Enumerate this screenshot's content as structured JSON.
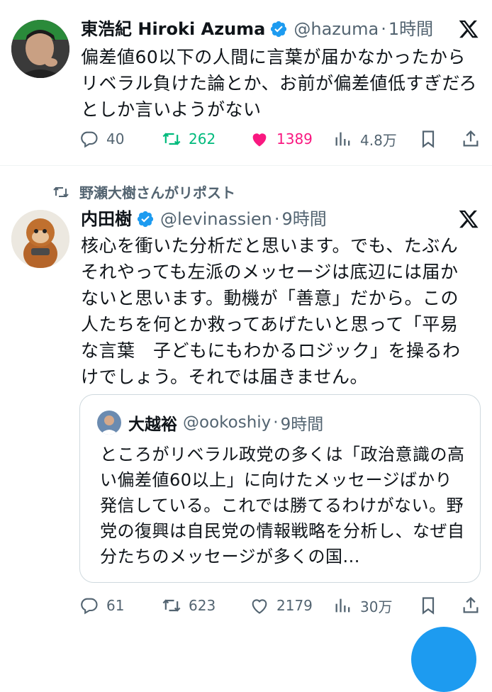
{
  "tweet1": {
    "name": "東浩紀 Hiroki Azuma",
    "handle": "@hazuma",
    "separator": "·",
    "time": "1時間",
    "body": "偏差値60以下の人間に言葉が届かなかったからリベラル負けた論とか、お前が偏差値低すぎだろとしか言いようがない",
    "replies": "40",
    "retweets": "262",
    "likes": "1389",
    "views": "4.8万",
    "liked": true,
    "retweeted_color": "#00ba7c",
    "like_color": "#f91880"
  },
  "tweet2": {
    "repost_label": "野瀬大樹さんがリポスト",
    "name": "内田樹",
    "handle": "@levinassien",
    "separator": "·",
    "time": "9時間",
    "body": "核心を衝いた分析だと思います。でも、たぶんそれやっても左派のメッセージは底辺には届かないと思います。動機が「善意」だから。この人たちを何とか救ってあげたいと思って「平易な言葉　子どもにもわかるロジック」を操るわけでしょう。それでは届きません。",
    "quote": {
      "name": "大越裕",
      "handle": "@ookoshiy",
      "separator": "·",
      "time": "9時間",
      "body": "ところがリベラル政党の多くは「政治意識の高い偏差値60以上」に向けたメッセージばかり発信している。これでは勝てるわけがない。野党の復興は自民党の情報戦略を分析し、なぜ自分たちのメッセージが多くの国..."
    },
    "replies": "61",
    "retweets": "623",
    "likes": "2179",
    "views": "30万"
  },
  "icons": {
    "verified": "verified-badge-icon",
    "platform": "x-logo-icon",
    "reply": "reply-icon",
    "retweet": "retweet-icon",
    "like": "heart-icon",
    "views": "views-chart-icon",
    "bookmark": "bookmark-icon",
    "share": "share-icon",
    "compose": "compose-fab"
  },
  "colors": {
    "accent": "#1d9bf0",
    "muted": "#536471"
  }
}
